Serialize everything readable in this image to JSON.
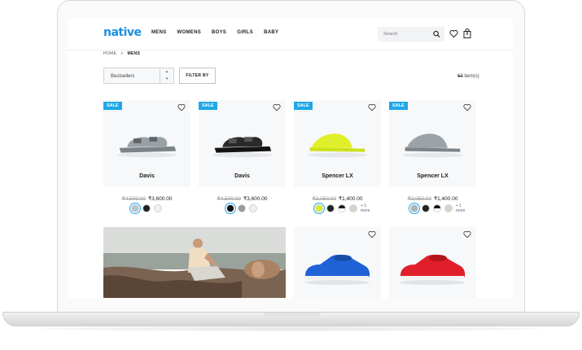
{
  "brand": {
    "logo_text": "native",
    "color": "#1b8fe0"
  },
  "nav": {
    "items": [
      "MENS",
      "WOMENS",
      "BOYS",
      "GIRLS",
      "BABY"
    ]
  },
  "search": {
    "placeholder": "Search"
  },
  "cart": {
    "count": "0"
  },
  "breadcrumb": {
    "home": "HOME",
    "separator": ">",
    "current": "MENS"
  },
  "filters": {
    "sort_value": "Bestsellers",
    "filter_label": "FILTER BY",
    "item_count_label": "item(s)",
    "item_count_value": "63"
  },
  "products": [
    {
      "name": "Davis",
      "sale": "SALE",
      "old_price": "₹4,500.00",
      "price": "₹3,600.00",
      "swatches": [
        "#b9c4cc",
        "#222222",
        "#f2f2f2"
      ],
      "more": ""
    },
    {
      "name": "Davis",
      "sale": "SALE",
      "old_price": "₹4,500.00",
      "price": "₹3,600.00",
      "swatches": [
        "#111111",
        "#9a9a9a",
        "#f0f0f0"
      ],
      "more": ""
    },
    {
      "name": "Spencer LX",
      "sale": "SALE",
      "old_price": "₹2,050.00",
      "price": "₹1,400.00",
      "swatches": [
        "#d8ee2a",
        "#222222",
        "#1a1a1a",
        "#d9d2c6"
      ],
      "more": "+ 1 more"
    },
    {
      "name": "Spencer LX",
      "sale": "SALE",
      "old_price": "₹2,050.00",
      "price": "₹1,400.00",
      "swatches": [
        "#a9b4bc",
        "#222222",
        "#111111",
        "#d9d2c6"
      ],
      "more": "+ 1 more"
    }
  ],
  "colors": {
    "sale_badge": "#1ea7e8",
    "card_bg": "#f7f8fa"
  }
}
